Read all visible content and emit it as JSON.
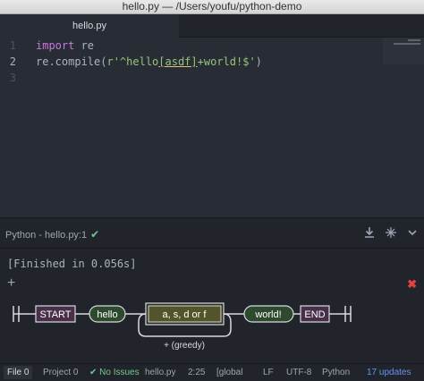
{
  "window": {
    "title": "hello.py — /Users/youfu/python-demo"
  },
  "tabs": [
    {
      "label": "hello.py"
    }
  ],
  "editor": {
    "line_numbers": [
      "1",
      "2",
      "3"
    ],
    "line1": {
      "keyword": "import",
      "rest": " re"
    },
    "line2": {
      "prefix": "re.compile(",
      "str_open": "r'^hello",
      "class": "[asdf]",
      "str_close": "+world!$'",
      "suffix": ")"
    }
  },
  "panel": {
    "title": "Python - hello.py:1",
    "check": "✔",
    "download_icon": "download-icon",
    "settings_icon": "pin-icon",
    "collapse_icon": "chevron-down-icon",
    "output": "[Finished in 0.056s]",
    "add": "+",
    "close": "✖"
  },
  "diagram": {
    "start": "START",
    "hello": "hello",
    "charset": "a, s, d or f",
    "loop": "+ (greedy)",
    "world": "world!",
    "end": "END"
  },
  "status": {
    "file_tab": "File",
    "file_count": "0",
    "project_tab": "Project",
    "project_count": "0",
    "issues": "✔ No Issues",
    "filename": "hello.py",
    "cursor": "2:25",
    "scope": "[global",
    "eol": "LF",
    "encoding": "UTF-8",
    "grammar": "Python",
    "updates": "17 updates"
  },
  "colors": {
    "background": "#282c34",
    "keyword": "#c678dd",
    "string": "#98c379",
    "success": "#73c990",
    "error": "#e0443e"
  }
}
